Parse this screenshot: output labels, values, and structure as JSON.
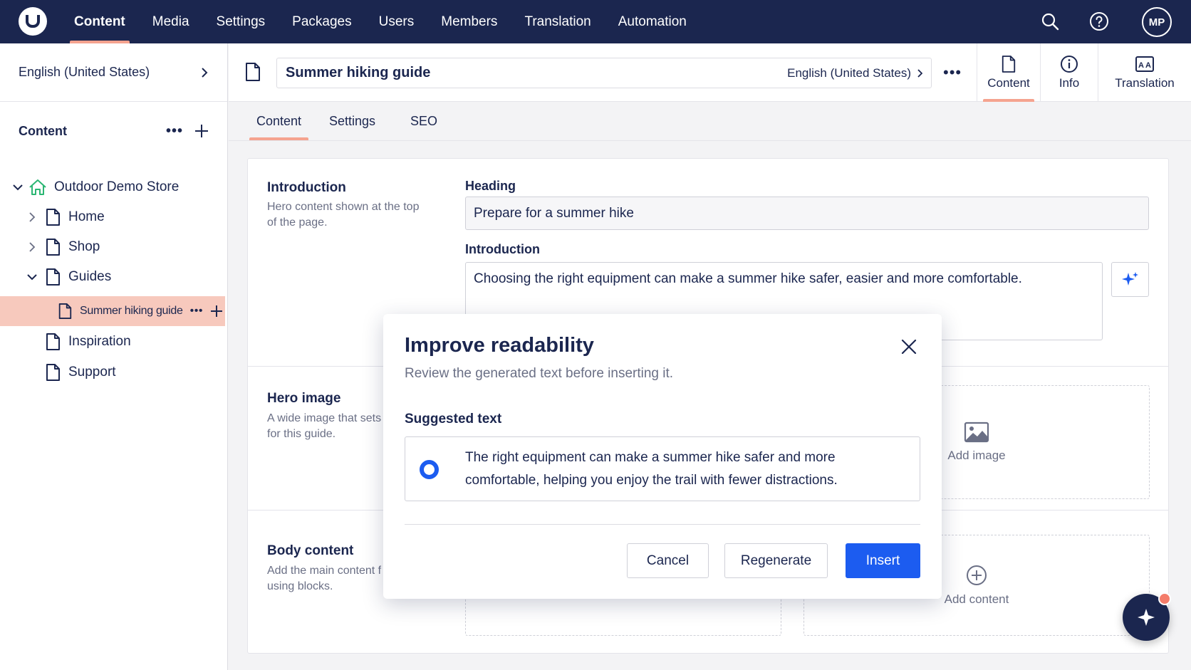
{
  "nav": {
    "items": [
      "Content",
      "Media",
      "Settings",
      "Packages",
      "Users",
      "Members",
      "Translation",
      "Automation"
    ],
    "active": "Content",
    "avatar_initials": "MP",
    "icons": [
      "search-icon",
      "help-icon"
    ]
  },
  "sidebar": {
    "language": "English (United States)",
    "tree_title": "Content",
    "tree": [
      {
        "label": "Outdoor Demo Store",
        "icon": "home-icon",
        "expanded": true
      },
      {
        "label": "Home",
        "icon": "page-icon",
        "expanded": false
      },
      {
        "label": "Shop",
        "icon": "page-icon",
        "expanded": false
      },
      {
        "label": "Guides",
        "icon": "page-icon",
        "expanded": true
      },
      {
        "label": "Summer hiking guide",
        "icon": "page-icon",
        "selected": true
      },
      {
        "label": "Inspiration",
        "icon": "page-icon"
      },
      {
        "label": "Support",
        "icon": "page-icon"
      }
    ]
  },
  "header": {
    "document_name": "Summer hiking guide",
    "language": "English (United States)",
    "apps": [
      "Content",
      "Info",
      "Translation"
    ],
    "active_app": "Content"
  },
  "tabs": {
    "items": [
      "Content",
      "Settings",
      "SEO"
    ],
    "active": "Content"
  },
  "editor": {
    "introduction": {
      "title": "Introduction",
      "description": "Hero content shown at the top of the page.",
      "heading_label": "Heading",
      "heading_value": "Prepare for a summer hike",
      "intro_label": "Introduction",
      "intro_value": "Choosing the right equipment can make a summer hike safer, easier and more comfortable."
    },
    "hero": {
      "title": "Hero image",
      "description": "A wide image that sets scene for this guide.",
      "add_label": "Add image"
    },
    "body": {
      "title": "Body content",
      "description": "Add the main content f guide using blocks.",
      "add_label": "Add content"
    }
  },
  "modal": {
    "title": "Improve readability",
    "subtitle": "Review the generated text before inserting it.",
    "suggested_label": "Suggested text",
    "suggestion": "The right equipment can make a summer hike safer and more comfortable, helping you enjoy the trail with fewer distractions.",
    "cancel": "Cancel",
    "regenerate": "Regenerate",
    "insert": "Insert"
  },
  "colors": {
    "nav_bg": "#1b264f",
    "accent": "#f5a38f",
    "primary": "#1c5cf0",
    "selected_row": "#f7c9bd"
  }
}
